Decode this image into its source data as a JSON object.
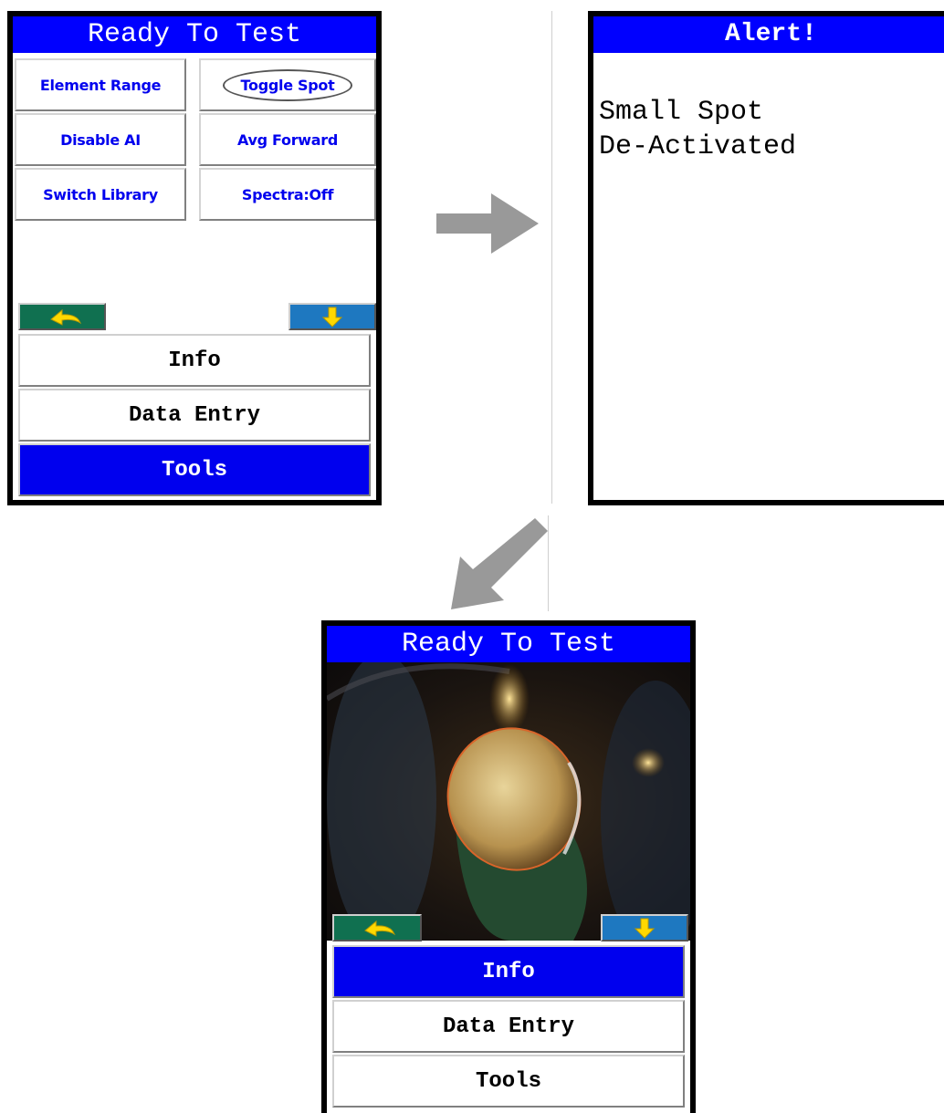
{
  "screen1": {
    "title": "Ready To Test",
    "buttons": [
      {
        "label": "Element Range"
      },
      {
        "label": "Toggle Spot"
      },
      {
        "label": "Disable AI"
      },
      {
        "label": "Avg Forward"
      },
      {
        "label": "Switch Library"
      },
      {
        "label": "Spectra:Off"
      }
    ],
    "menu": [
      {
        "label": "Info"
      },
      {
        "label": "Data Entry"
      },
      {
        "label": "Tools"
      }
    ]
  },
  "alert": {
    "title": "Alert!",
    "message_line1": "Small Spot",
    "message_line2": "De-Activated"
  },
  "screen3": {
    "title": "Ready To Test",
    "menu": [
      {
        "label": "Info"
      },
      {
        "label": "Data Entry"
      },
      {
        "label": "Tools"
      }
    ]
  },
  "colors": {
    "title_blue": "#0000ff",
    "selected_blue": "#0000ee",
    "back_button": "#107050",
    "down_button": "#1e78c0",
    "arrow_yellow": "#ffd800",
    "connector_arrow": "#999999"
  },
  "icons": [
    "back-arrow-icon",
    "down-arrow-icon",
    "right-arrow-icon",
    "down-left-arrow-icon"
  ]
}
